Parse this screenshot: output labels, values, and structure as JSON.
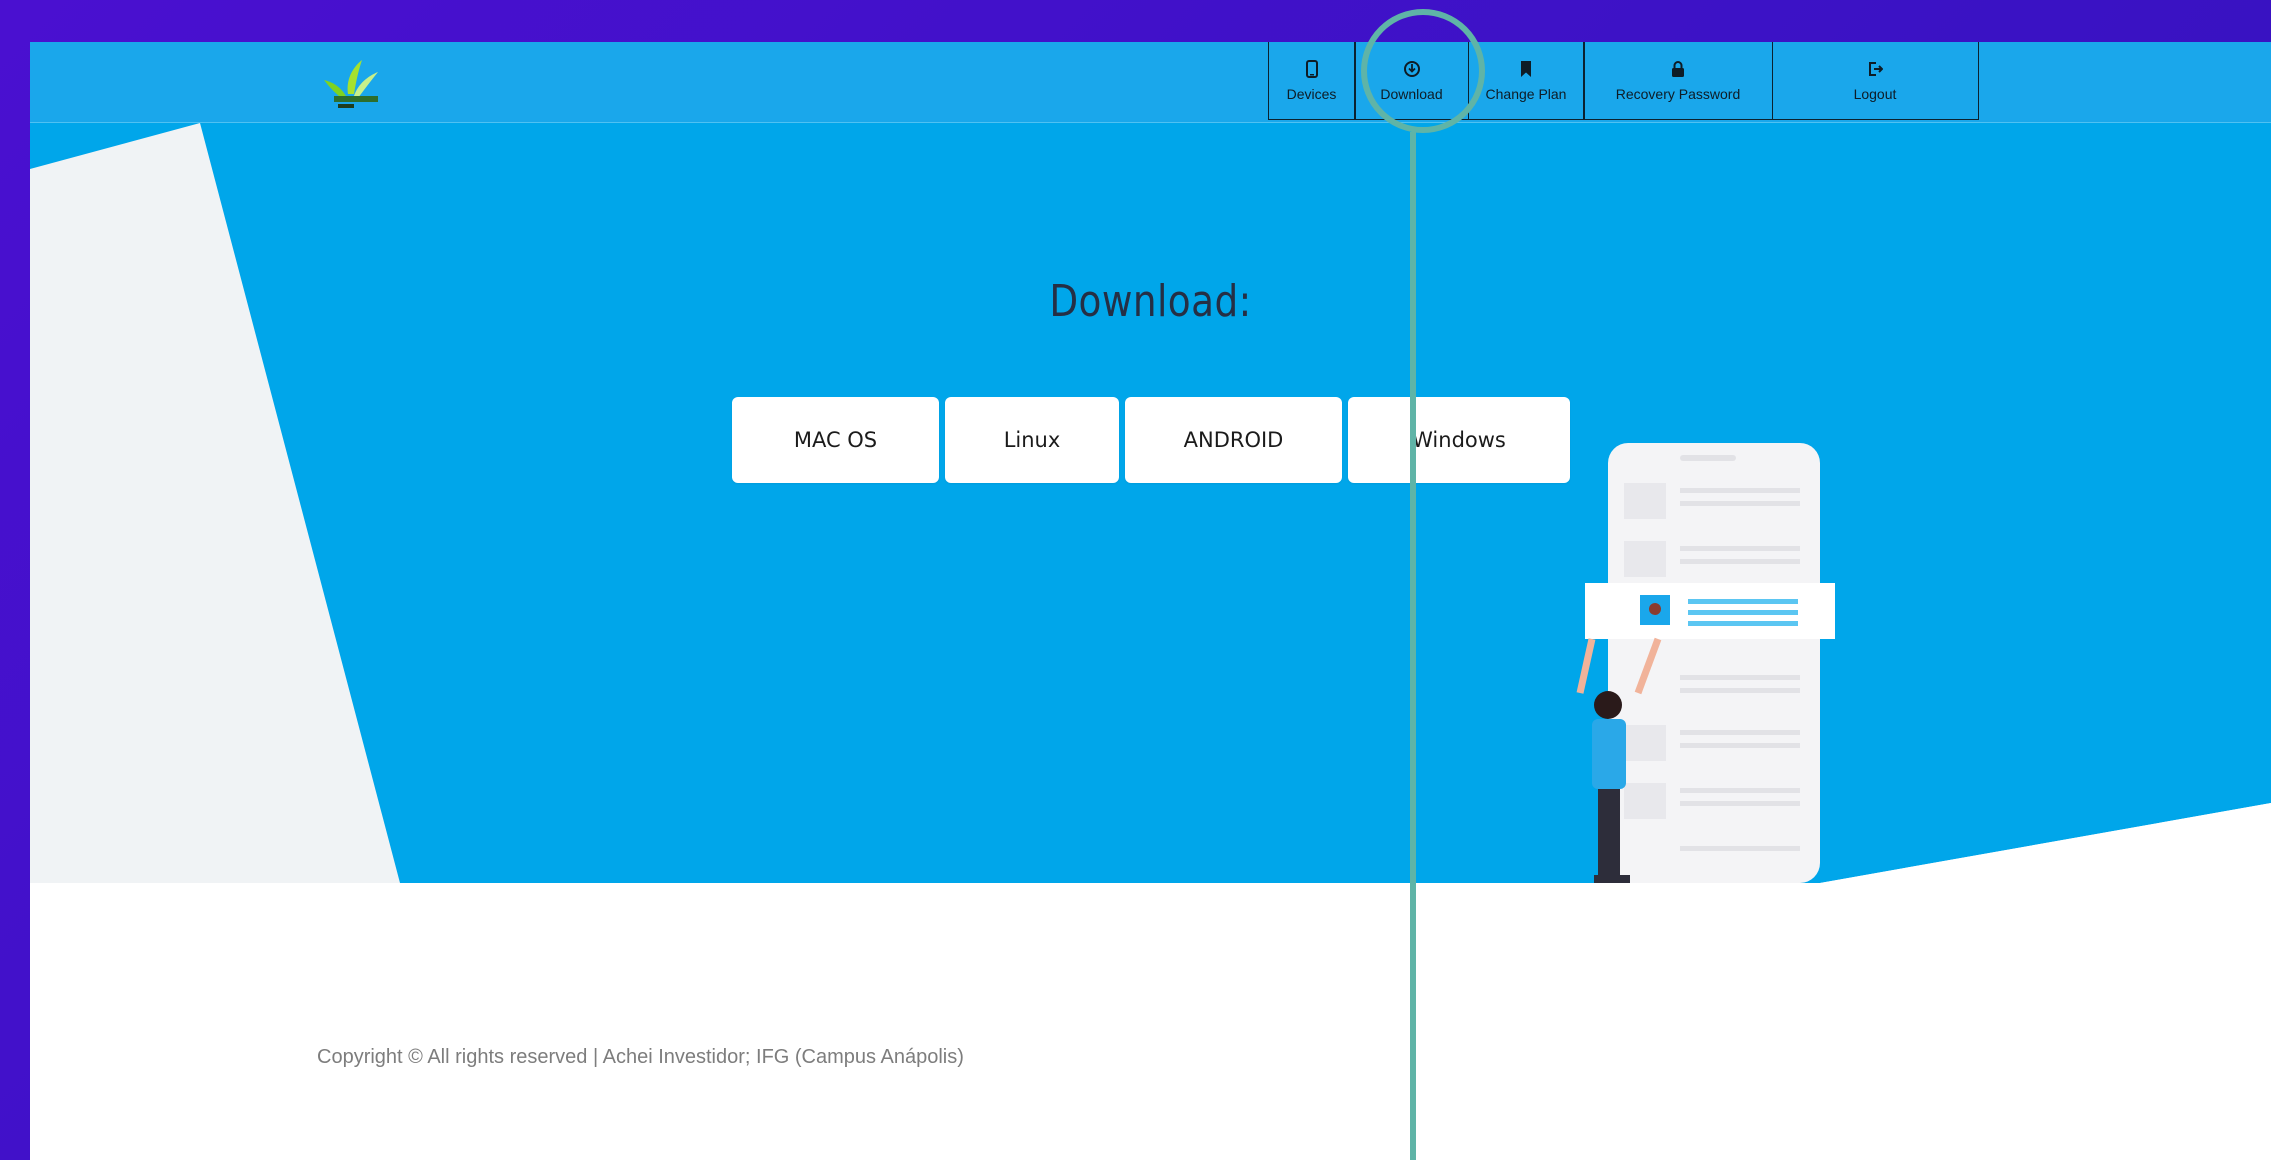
{
  "nav": {
    "items": [
      {
        "label": "Devices",
        "icon": "phone-icon"
      },
      {
        "label": "Download",
        "icon": "download-circle-icon"
      },
      {
        "label": "Change Plan",
        "icon": "bookmark-icon"
      },
      {
        "label": "Recovery Password",
        "icon": "lock-icon"
      },
      {
        "label": "Logout",
        "icon": "logout-icon"
      }
    ]
  },
  "main": {
    "title": "Download:",
    "buttons": [
      "MAC OS",
      "Linux",
      "ANDROID",
      "Windows"
    ]
  },
  "footer": {
    "text": "Copyright © All rights reserved | Achei Investidor; IFG (Campus Anápolis)"
  },
  "colors": {
    "frame_purple": "#3f11c8",
    "topbar_blue": "#1aa7eb",
    "hero_blue": "#00a6ea",
    "light_panel": "#f0f3f5",
    "annotation": "#5fb4a7"
  }
}
